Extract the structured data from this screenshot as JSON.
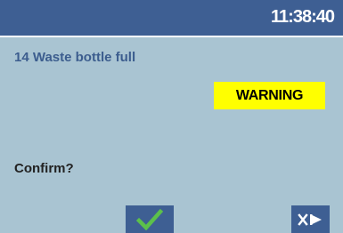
{
  "header": {
    "clock": "11:38:40"
  },
  "message": {
    "title": "14 Waste bottle full",
    "severity": "WARNING",
    "prompt": "Confirm?"
  },
  "colors": {
    "background": "#a9c4d2",
    "bar": "#3e5f93",
    "title_text": "#3c5d8e",
    "warning_bg": "#ffff00",
    "confirm_check": "#5cc04b"
  },
  "buttons": {
    "confirm_icon": "checkmark-icon",
    "exit_icon": "exit-icon"
  }
}
